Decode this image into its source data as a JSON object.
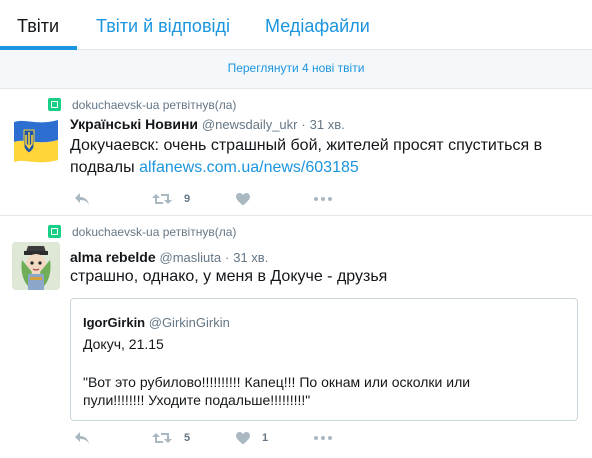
{
  "tabs": [
    {
      "label": "Твіти"
    },
    {
      "label": "Твіти й відповіді"
    },
    {
      "label": "Медіафайли"
    }
  ],
  "new_tweets_bar": "Переглянути 4 нові твіти",
  "tweets": [
    {
      "retweeted_by": "dokuchaevsk-ua ретвітнув(ла)",
      "name": "Українські Новини",
      "handle": "@newsdaily_ukr",
      "dot": "·",
      "time": "31 хв.",
      "text": "Докучаевск: очень страшный бой, жителей просят спуститься в подвалы",
      "link": "alfanews.com.ua/news/603185",
      "retweets": "9",
      "likes": ""
    },
    {
      "retweeted_by": "dokuchaevsk-ua ретвітнув(ла)",
      "name": "alma rebelde",
      "handle": "@masliuta",
      "dot": "·",
      "time": "31 хв.",
      "text": "страшно, однако, у меня в Докуче -  друзья",
      "retweets": "5",
      "likes": "1",
      "quote": {
        "name": "IgorGirkin",
        "handle": "@GirkinGirkin",
        "line1": "Докуч, 21.15",
        "line2": "\"Вот это рубилово!!!!!!!!!! Капец!!! По окнам или осколки или",
        "line3": "пули!!!!!!!! Уходите подальше!!!!!!!!!\""
      }
    }
  ],
  "colors": {
    "accent": "#1b95e0",
    "retweet_green": "#19cf86",
    "muted": "#657786",
    "icon_gray": "#aab8c2",
    "border": "#e1e8ed",
    "bar_bg": "#f5f8fa"
  },
  "icons": [
    "retweet-badge-icon",
    "reply-icon",
    "retweet-icon",
    "like-icon",
    "more-icon"
  ]
}
